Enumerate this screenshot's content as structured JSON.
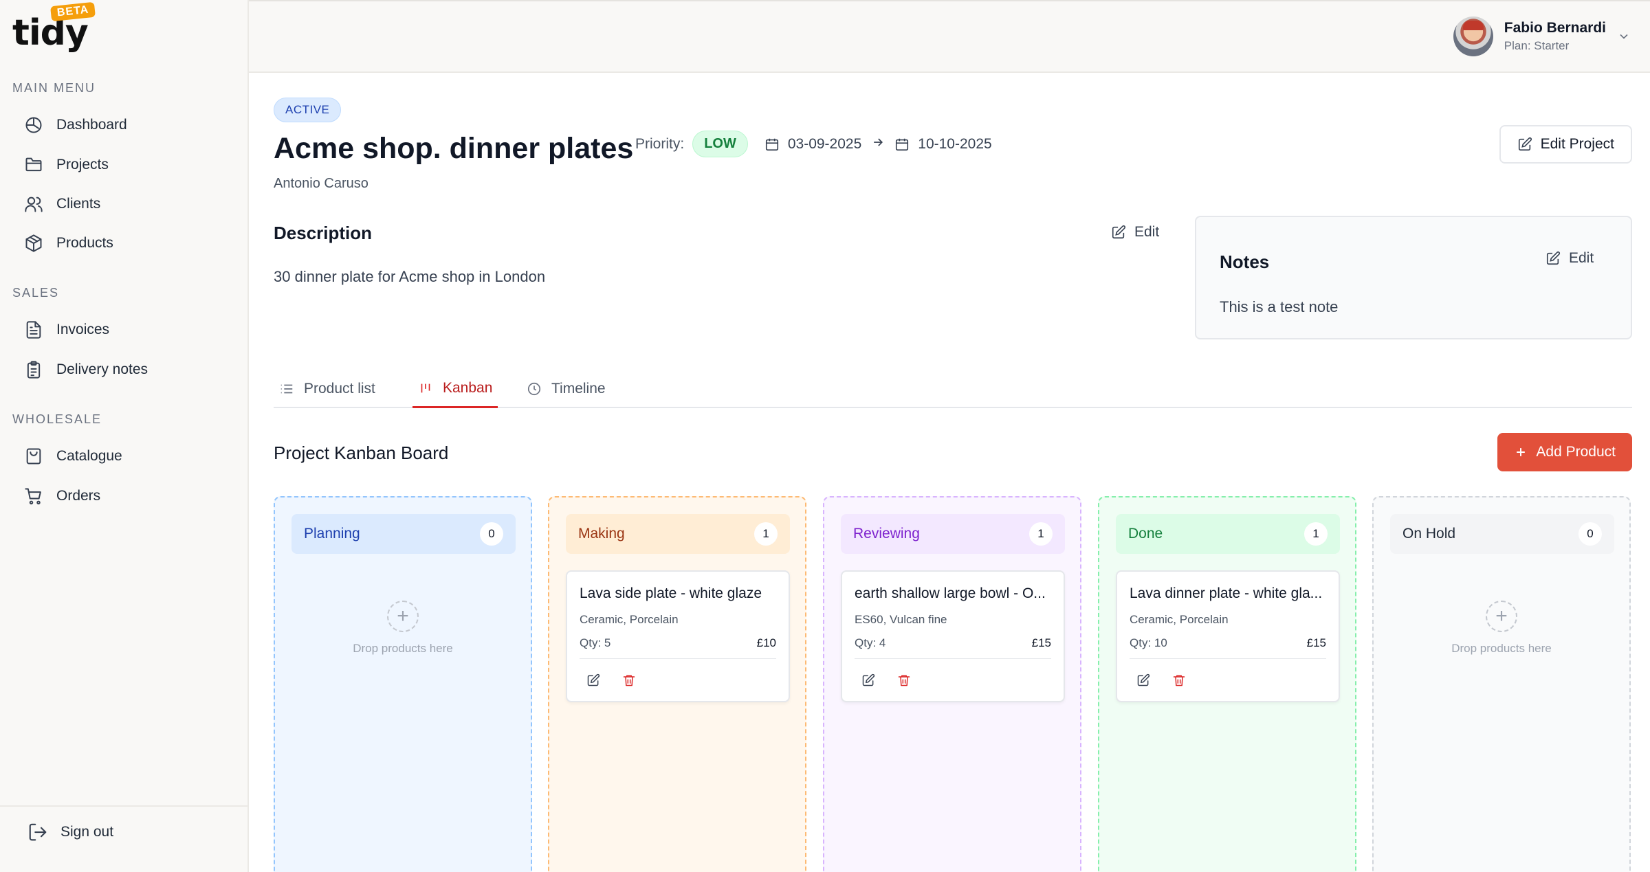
{
  "app": {
    "logo": "tidy",
    "beta_label": "BETA"
  },
  "sidebar": {
    "sections": [
      {
        "title": "MAIN MENU",
        "items": [
          "Dashboard",
          "Projects",
          "Clients",
          "Products"
        ]
      },
      {
        "title": "SALES",
        "items": [
          "Invoices",
          "Delivery notes"
        ]
      },
      {
        "title": "WHOLESALE",
        "items": [
          "Catalogue",
          "Orders"
        ]
      }
    ],
    "sign_out": "Sign out"
  },
  "header": {
    "user_name": "Fabio Bernardi",
    "user_plan": "Plan: Starter"
  },
  "project": {
    "status": "ACTIVE",
    "title": "Acme shop. dinner plates",
    "client": "Antonio Caruso",
    "priority_label": "Priority:",
    "priority": "LOW",
    "start_date": "03-09-2025",
    "end_date": "10-10-2025",
    "edit_label": "Edit Project"
  },
  "description": {
    "title": "Description",
    "text": "30 dinner plate for Acme shop in London",
    "edit_label": "Edit"
  },
  "notes": {
    "title": "Notes",
    "text": "This is a test note",
    "edit_label": "Edit"
  },
  "tabs": [
    "Product list",
    "Kanban",
    "Timeline"
  ],
  "active_tab": "Kanban",
  "board": {
    "title": "Project Kanban Board",
    "add_label": "Add Product",
    "drop_text": "Drop products here",
    "drop_plus": "+",
    "columns": [
      {
        "name": "Planning",
        "count": "0",
        "color": "#1e40af",
        "bg": "#eff6ff",
        "head_bg": "#dbeafe",
        "border": "#93c5fd"
      },
      {
        "name": "Making",
        "count": "1",
        "color": "#9a3412",
        "bg": "#fff7ed",
        "head_bg": "#ffedd5",
        "border": "#fdba74"
      },
      {
        "name": "Reviewing",
        "count": "1",
        "color": "#7e22ce",
        "bg": "#faf5ff",
        "head_bg": "#f3e8ff",
        "border": "#d8b4fe"
      },
      {
        "name": "Done",
        "count": "1",
        "color": "#15803d",
        "bg": "#f0fdf4",
        "head_bg": "#dcfce7",
        "border": "#86efac"
      },
      {
        "name": "On Hold",
        "count": "0",
        "color": "#1f2937",
        "bg": "#f9fafb",
        "head_bg": "#f3f4f6",
        "border": "#d1d5db"
      }
    ],
    "cards": [
      {
        "name": "Lava side plate - white glaze",
        "material": "Ceramic, Porcelain",
        "qty": "Qty: 5",
        "price": "£10"
      },
      {
        "name": "earth shallow large bowl - O...",
        "material": "ES60, Vulcan fine",
        "qty": "Qty: 4",
        "price": "£15"
      },
      {
        "name": "Lava dinner plate - white gla...",
        "material": "Ceramic, Porcelain",
        "qty": "Qty: 10",
        "price": "£15"
      }
    ]
  },
  "colors": {
    "accent": "#e2503a",
    "delete": "#dc2626"
  }
}
